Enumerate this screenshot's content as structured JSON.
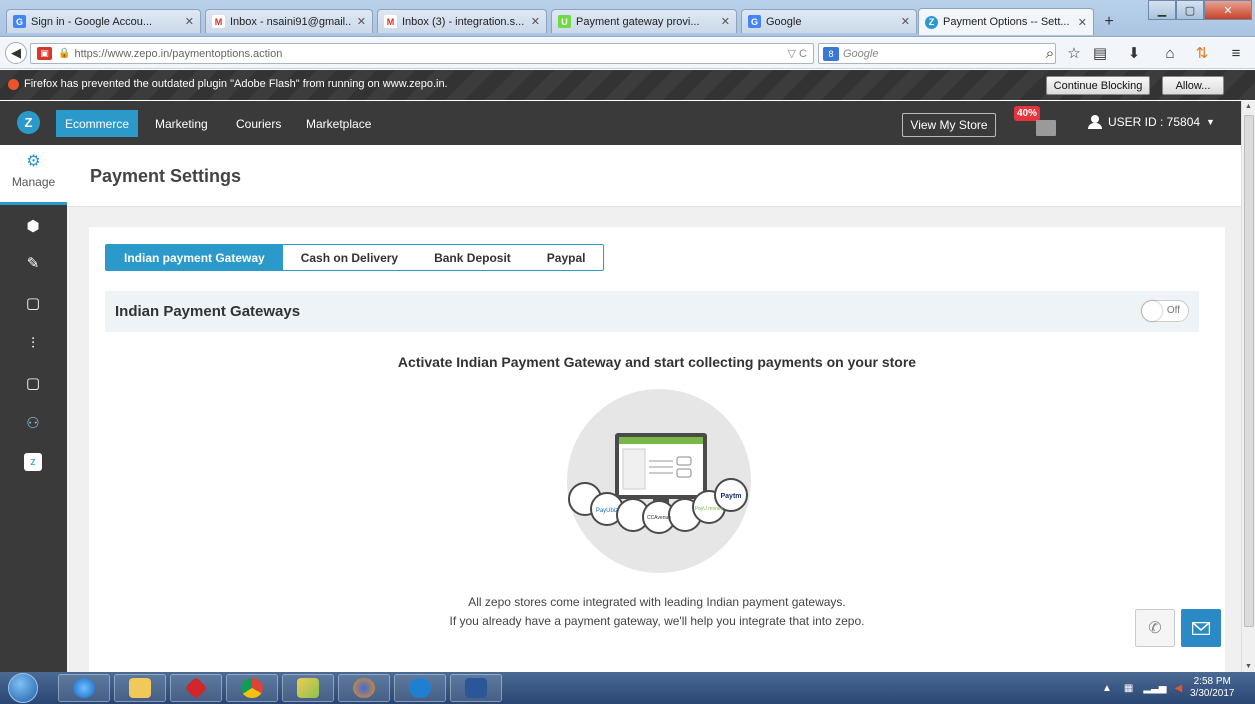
{
  "browser": {
    "tabs": [
      {
        "label": "Sign in - Google Accou...",
        "icon": "google-g-icon",
        "color": "#4285f4"
      },
      {
        "label": "Inbox - nsaini91@gmail....",
        "icon": "gmail-icon",
        "color": "#d93025"
      },
      {
        "label": "Inbox (3) - integration.s...",
        "icon": "gmail-icon",
        "color": "#d93025"
      },
      {
        "label": "Payment gateway provi...",
        "icon": "upwork-icon",
        "color": "#6fda44"
      },
      {
        "label": "Google",
        "icon": "google-g-icon",
        "color": "#4285f4"
      },
      {
        "label": "Payment Options -- Sett...",
        "icon": "zepo-icon",
        "color": "#2b9acb"
      }
    ],
    "url": "https://www.zepo.in/paymentoptions.action",
    "search_placeholder": "Google",
    "plugin_message": "Firefox has prevented the outdated plugin \"Adobe Flash\" from running on www.zepo.in.",
    "continue_blocking": "Continue Blocking",
    "allow": "Allow..."
  },
  "app": {
    "logo": "Z",
    "menu": [
      "Ecommerce",
      "Marketing",
      "Couriers",
      "Marketplace"
    ],
    "view_store": "View My Store",
    "promo_badge": "40%",
    "user_id": "USER ID : 75804",
    "sidebar_manage": "Manage"
  },
  "page": {
    "title": "Payment Settings",
    "tabs": [
      "Indian payment Gateway",
      "Cash on Delivery",
      "Bank Deposit",
      "Paypal"
    ],
    "section_title": "Indian Payment Gateways",
    "toggle_label": "Off",
    "headline": "Activate Indian Payment Gateway and start collecting payments on your store",
    "note_line1": "All zepo stores come integrated with leading Indian payment gateways.",
    "note_line2": "If you already have a payment gateway, we'll help you integrate that into zepo.",
    "gateway_logos": [
      "PayUbiz",
      "CCAvenue",
      "PayU money",
      "Paytm"
    ]
  },
  "taskbar": {
    "time": "2:58 PM",
    "date": "3/30/2017"
  },
  "colors": {
    "accent": "#2b9acb",
    "header": "#3a3a3a"
  }
}
